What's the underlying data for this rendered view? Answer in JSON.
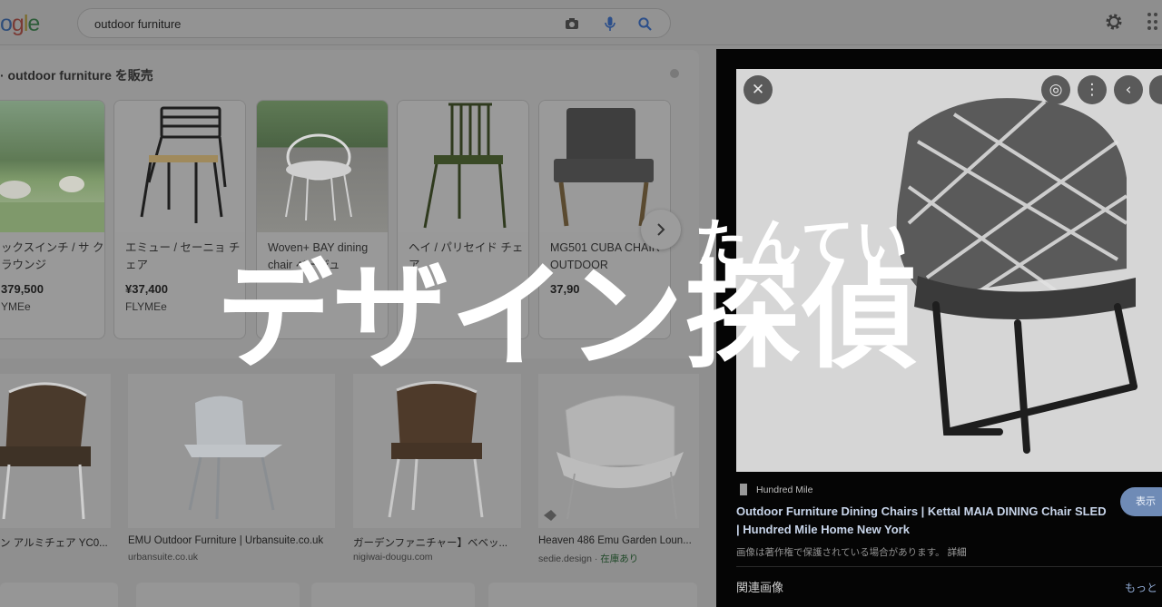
{
  "header": {
    "logo_letters": [
      "o",
      "g",
      "l",
      "e"
    ],
    "search_value": "outdoor furniture",
    "icons": [
      "camera-icon",
      "microphone-icon",
      "search-icon",
      "settings-gear-icon",
      "apps-grid-icon"
    ]
  },
  "shopping": {
    "title": "· outdoor furniture を販売",
    "cards": [
      {
        "name": "ックスインチ / サ クルラウンジ",
        "price": "379,500",
        "shop": "YMEe"
      },
      {
        "name": "エミュー / セーニョ チェア",
        "price": "¥37,400",
        "shop": "FLYMEe"
      },
      {
        "name": "Woven+ BAY dining chair ベージュ",
        "price": "",
        "shop": ""
      },
      {
        "name": "ヘイ / パリセイド チェア",
        "price": "",
        "shop": ""
      },
      {
        "name": "MG501 CUBA CHAIR OUTDOOR",
        "price": "37,90",
        "shop": ""
      }
    ]
  },
  "results": [
    {
      "title": "ン アルミチェア YC0...",
      "source": "",
      "stock": ""
    },
    {
      "title": "EMU Outdoor Furniture | Urbansuite.co.uk",
      "source": "urbansuite.co.uk",
      "stock": ""
    },
    {
      "title": "ガーデンファニチャー】ベベッ...",
      "source": "nigiwai-dougu.com",
      "stock": ""
    },
    {
      "title": "Heaven 486 Emu Garden Loun...",
      "source": "sedie.design · ",
      "stock": "在庫あり"
    }
  ],
  "panel": {
    "source": "Hundred Mile",
    "title": "Outdoor Furniture Dining Chairs | Kettal MAIA DINING Chair SLED | Hundred Mile Home New York",
    "view_button": "表示",
    "notice": "画像は著作権で保護されている場合があります。",
    "notice_more": "詳細",
    "related": "関連画像",
    "related_more": "もっと"
  },
  "overlay": {
    "subtitle": "たんてい",
    "title": "デザイン探偵"
  },
  "colors": {
    "panel_title": "#c8d5ea",
    "view_button": "#6f8bb6",
    "stock": "#214a2a",
    "overlay_text": "#ffffff"
  }
}
